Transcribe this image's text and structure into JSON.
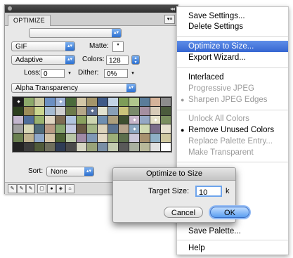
{
  "panel": {
    "tab_label": "OPTIMIZE",
    "preset_value": "",
    "format_value": "GIF",
    "matte_label": "Matte:",
    "palette_value": "Adaptive",
    "colors_label": "Colors:",
    "colors_value": "128",
    "loss_label": "Loss:",
    "loss_value": "0",
    "dither_label": "Dither:",
    "dither_value": "0%",
    "transparency_value": "Alpha Transparency",
    "sort_label": "Sort:",
    "sort_value": "None",
    "swatches": [
      "#1c1c1c",
      "#8ca86a",
      "#c7c7a0",
      "#6b8fc2",
      "#9fb3d6",
      "#4a6a3b",
      "#d3c7a7",
      "#a4956a",
      "#3f5a87",
      "#c2d4e5",
      "#7e9d58",
      "#b0c78d",
      "#5b7c99",
      "#d5b39a",
      "#8c8c8c",
      "#2c3f1e",
      "#9c8c5a",
      "#cbd68f",
      "#a7bcd2",
      "#d0d0d0",
      "#6c7a4a",
      "#b6a889",
      "#5e6f8f",
      "#e3e3d0",
      "#89a0b7",
      "#c9c27a",
      "#7a8a6b",
      "#a58fa0",
      "#d7cbb8",
      "#4b5b3c",
      "#c3b6ce",
      "#506d9a",
      "#9ab26f",
      "#e0d6c2",
      "#7d6b52",
      "#b0c4de",
      "#8aa15f",
      "#cdd5b0",
      "#6f8fb0",
      "#ad9f7d",
      "#3c4e2f",
      "#c7b5c9",
      "#94a7c4",
      "#e5e1c9",
      "#7b8f5f",
      "#a0a0a0",
      "#d7d7b5",
      "#4f6b7a",
      "#b99a84",
      "#88a670",
      "#c4c9e0",
      "#6a5a44",
      "#a3b686",
      "#dcd3bb",
      "#5a7290",
      "#b5a48c",
      "#8ba6c0",
      "#cfd9b1",
      "#7a6c8a",
      "#e8e2d0",
      "#6a8050",
      "#c0b390",
      "#90a9cb",
      "#d4c4a6",
      "#4c6233",
      "#b8c6a5",
      "#a08aa6",
      "#7f98b6",
      "#e3d9c4",
      "#9cae78",
      "#5c6f4c",
      "#cbc7d9",
      "#a7916f",
      "#8fb0c6",
      "#d0c9a0",
      "#232323",
      "#3b3b3b",
      "#505a3a",
      "#6e6e5c",
      "#2f3c55",
      "#4a4a4a",
      "#d5d5c2",
      "#99a37a",
      "#7a8fa6",
      "#c3cbb0",
      "#595959",
      "#a9b0a0",
      "#b8b89a",
      "#e0e0e0",
      "#ffffff"
    ],
    "marked_swatches": [
      0,
      4,
      22,
      41,
      43,
      56
    ]
  },
  "menu": {
    "items": [
      {
        "label": "Save Settings...",
        "state": "enabled"
      },
      {
        "label": "Delete Settings",
        "state": "enabled"
      },
      {
        "label": "Optimize to Size...",
        "state": "highlighted"
      },
      {
        "label": "Export Wizard...",
        "state": "enabled"
      },
      {
        "label": "Interlaced",
        "state": "enabled"
      },
      {
        "label": "Progressive JPEG",
        "state": "disabled"
      },
      {
        "label": "Sharpen JPEG Edges",
        "state": "disabled"
      },
      {
        "label": "Unlock All Colors",
        "state": "disabled"
      },
      {
        "label": "Remove Unused Colors",
        "state": "checked"
      },
      {
        "label": "Replace Palette Entry...",
        "state": "disabled"
      },
      {
        "label": "Make Transparent",
        "state": "disabled"
      },
      {
        "label": "Save Palette...",
        "state": "enabled"
      },
      {
        "label": "Help",
        "state": "enabled"
      }
    ]
  },
  "dialog": {
    "title": "Optimize to Size",
    "target_label": "Target Size:",
    "target_value": "10",
    "unit": "k",
    "cancel_label": "Cancel",
    "ok_label": "OK"
  }
}
